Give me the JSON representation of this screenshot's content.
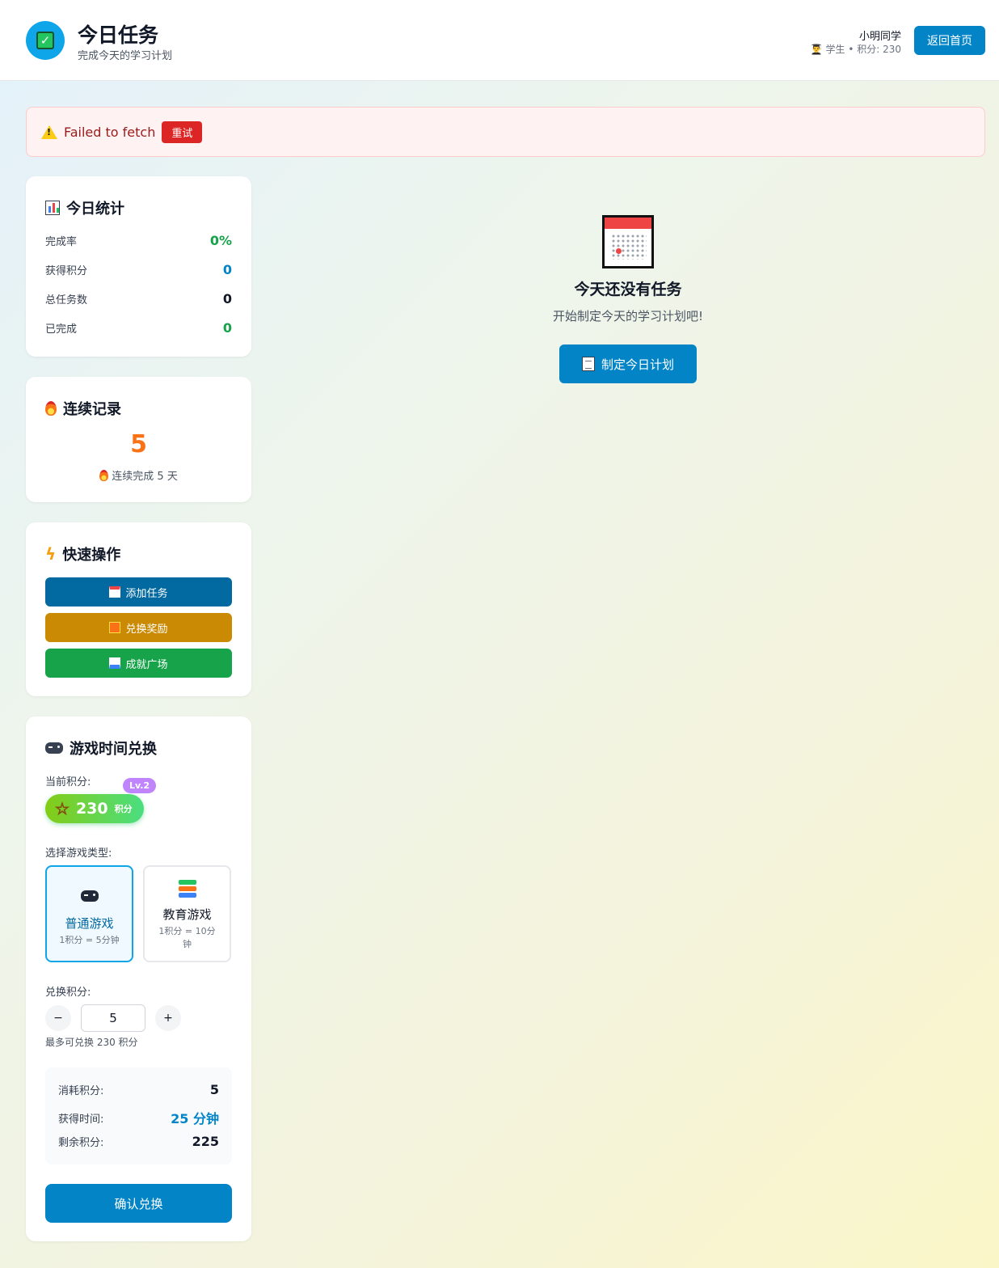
{
  "header": {
    "title": "今日任务",
    "subtitle": "完成今天的学习计划",
    "user_name": "小明同学",
    "user_meta": "👨‍🎓 学生 • 积分: 230",
    "home_button": "返回首页"
  },
  "error": {
    "message": "Failed to fetch",
    "retry_label": "重试"
  },
  "stats": {
    "title": "今日统计",
    "rows": [
      {
        "label": "完成率",
        "value": "0%",
        "color": "#16a34a"
      },
      {
        "label": "获得积分",
        "value": "0",
        "color": "#0284c7"
      },
      {
        "label": "总任务数",
        "value": "0",
        "color": "#111827"
      },
      {
        "label": "已完成",
        "value": "0",
        "color": "#16a34a"
      }
    ]
  },
  "streak": {
    "title": "连续记录",
    "days": "5",
    "text": "连续完成 5 天"
  },
  "quick_actions": {
    "title": "快速操作",
    "buttons": [
      {
        "label": "添加任务",
        "color": "#0369a1"
      },
      {
        "label": "兑换奖励",
        "color": "#ca8a04"
      },
      {
        "label": "成就广场",
        "color": "#16a34a"
      }
    ]
  },
  "game_exchange": {
    "title": "游戏时间兑换",
    "current_points_label": "当前积分:",
    "points": "230",
    "points_unit": "积分",
    "level": "Lv.2",
    "choose_type_label": "选择游戏类型:",
    "types": [
      {
        "name": "普通游戏",
        "rate": "1积分 = 5分钟",
        "selected": true
      },
      {
        "name": "教育游戏",
        "rate": "1积分 = 10分钟",
        "selected": false
      }
    ],
    "exchange_label": "兑换积分:",
    "minus": "−",
    "plus": "+",
    "amount": "5",
    "max_hint": "最多可兑换 230 积分",
    "summary": {
      "cost_label": "消耗积分:",
      "cost_value": "5",
      "time_label": "获得时间:",
      "time_value": "25 分钟",
      "remain_label": "剩余积分:",
      "remain_value": "225"
    },
    "confirm_label": "确认兑换"
  },
  "empty_state": {
    "title": "今天还没有任务",
    "subtitle": "开始制定今天的学习计划吧!",
    "button_label": "制定今日计划"
  }
}
